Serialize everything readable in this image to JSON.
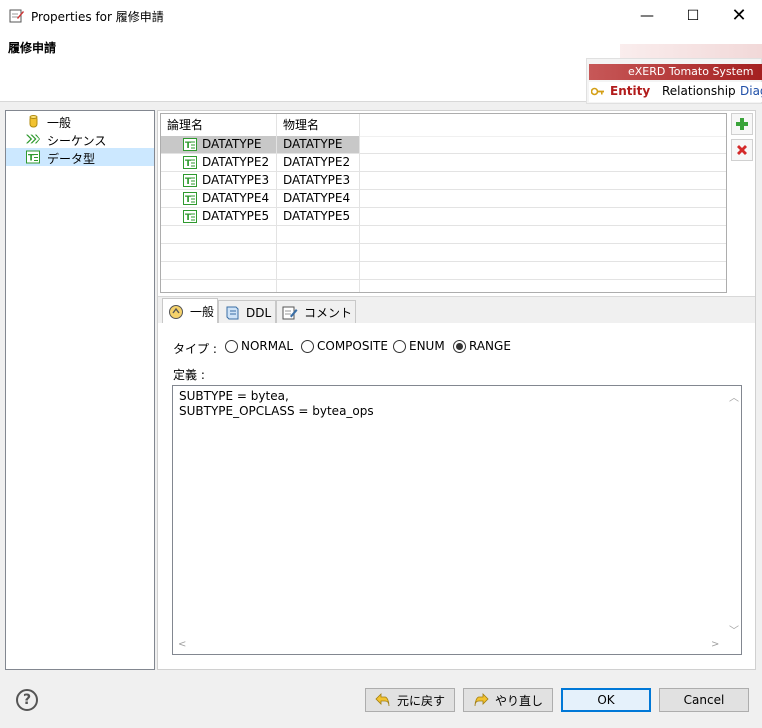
{
  "window": {
    "title": "Properties for 履修申請",
    "minimize": "—",
    "maximize": "☐",
    "close": "✕"
  },
  "header": {
    "title": "履修申請"
  },
  "banner": {
    "brand": "eXERD  Tomato System",
    "tabs": [
      "Entity",
      "Relationship",
      "Diag"
    ]
  },
  "tree": {
    "items": [
      {
        "label": "一般",
        "icon": "cylinder-icon",
        "selected": false
      },
      {
        "label": "シーケンス",
        "icon": "sequence-arrows-icon",
        "selected": false
      },
      {
        "label": "データ型",
        "icon": "datatype-icon",
        "selected": true
      }
    ]
  },
  "table": {
    "columns": [
      "論理名",
      "物理名"
    ],
    "rows": [
      {
        "logical": "DATATYPE",
        "physical": "DATATYPE",
        "selected": true
      },
      {
        "logical": "DATATYPE2",
        "physical": "DATATYPE2",
        "selected": false
      },
      {
        "logical": "DATATYPE3",
        "physical": "DATATYPE3",
        "selected": false
      },
      {
        "logical": "DATATYPE4",
        "physical": "DATATYPE4",
        "selected": false
      },
      {
        "logical": "DATATYPE5",
        "physical": "DATATYPE5",
        "selected": false
      }
    ]
  },
  "tabs": [
    {
      "label": "一般",
      "icon": "general-tab-icon",
      "active": true
    },
    {
      "label": "DDL",
      "icon": "ddl-scroll-icon",
      "active": false
    },
    {
      "label": "コメント",
      "icon": "comment-edit-icon",
      "active": false
    }
  ],
  "general": {
    "type_label": "タイプ :",
    "type_options": [
      "NORMAL",
      "COMPOSITE",
      "ENUM",
      "RANGE"
    ],
    "type_selected": "RANGE",
    "definition_label": "定義 :",
    "definition": "SUBTYPE = bytea,\nSUBTYPE_OPCLASS = bytea_ops"
  },
  "buttons": {
    "help": "?",
    "revert": "元に戻す",
    "redo": "やり直し",
    "ok": "OK",
    "cancel": "Cancel"
  },
  "colors": {
    "selection": "#cce8ff",
    "row_selected": "#c8c8c8",
    "banner_red": "#a42020",
    "primary_border": "#0078d7"
  }
}
